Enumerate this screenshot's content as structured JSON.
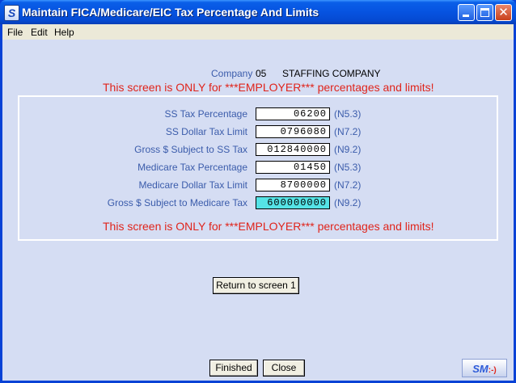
{
  "window": {
    "title": "Maintain FICA/Medicare/EIC Tax Percentage And Limits",
    "icon_letter": "S"
  },
  "menu": [
    "File",
    "Edit",
    "Help"
  ],
  "company": {
    "label": "Company",
    "code": "05",
    "name": "STAFFING COMPANY"
  },
  "warning": "This screen is ONLY for ***EMPLOYER*** percentages and limits!",
  "fields": [
    {
      "label": "SS Tax Percentage",
      "value": "06200",
      "format": "(N5.3)",
      "highlight": false
    },
    {
      "label": "SS Dollar Tax Limit",
      "value": "0796080",
      "format": "(N7.2)",
      "highlight": false
    },
    {
      "label": "Gross $ Subject to SS Tax",
      "value": "012840000",
      "format": "(N9.2)",
      "highlight": false
    },
    {
      "label": "Medicare Tax Percentage",
      "value": "01450",
      "format": "(N5.3)",
      "highlight": false
    },
    {
      "label": "Medicare Dollar Tax Limit",
      "value": "8700000",
      "format": "(N7.2)",
      "highlight": false
    },
    {
      "label": "Gross $ Subject to Medicare Tax",
      "value": "600000000",
      "format": "(N9.2)",
      "highlight": true
    }
  ],
  "buttons": {
    "return": "Return to screen 1",
    "finished": "Finished",
    "close": "Close"
  },
  "logo": {
    "text": "SM",
    "smiley": ":-)"
  },
  "colors": {
    "label_blue": "#3b5cab",
    "warning_red": "#e0241b",
    "highlight_cyan": "#55e3e6",
    "client_bg": "#d5ddf3"
  }
}
